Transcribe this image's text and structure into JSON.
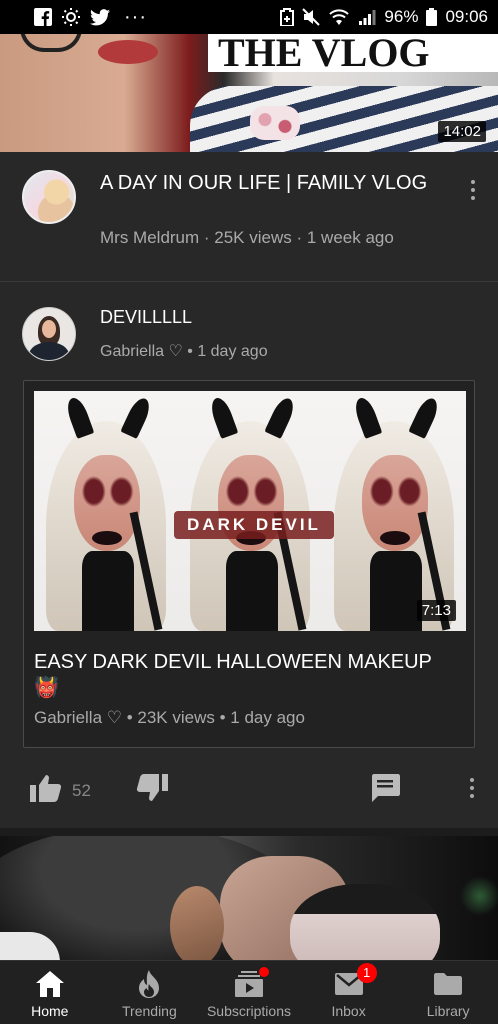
{
  "status_bar": {
    "left_icons": [
      "facebook-icon",
      "brightness-icon",
      "twitter-icon"
    ],
    "more": "···",
    "right_icons": [
      "data-saver-icon",
      "mute-icon",
      "wifi-icon",
      "signal-icon",
      "battery-icon"
    ],
    "battery": "96%",
    "time": "09:06"
  },
  "top_video": {
    "banner_text": "THE VLOG",
    "duration": "14:02",
    "title": "A DAY IN OUR LIFE | FAMILY VLOG",
    "channel_meta": "Mrs Meldrum · 25K views · 1 week ago"
  },
  "post": {
    "title": "DEVILLLLL",
    "meta": "Gabriella ♡ • 1 day ago",
    "embed": {
      "thumb_text": "DARK DEVIL",
      "duration": "7:13",
      "title": "EASY DARK DEVIL HALLOWEEN MAKEUP 👹",
      "meta": "Gabriella ♡ • 23K views • 1 day ago"
    },
    "actions": {
      "like_count": "52"
    }
  },
  "bottom_nav": {
    "items": [
      {
        "label": "Home",
        "icon": "home-icon",
        "active": true
      },
      {
        "label": "Trending",
        "icon": "flame-icon"
      },
      {
        "label": "Subscriptions",
        "icon": "subscriptions-icon"
      },
      {
        "label": "Inbox",
        "icon": "inbox-icon",
        "badge": "1"
      },
      {
        "label": "Library",
        "icon": "folder-icon"
      }
    ]
  },
  "colors": {
    "background": "#282828",
    "nav_background": "#212121",
    "text_primary": "#ffffff",
    "text_secondary": "#aaaaaa",
    "badge_red": "#ff0000"
  }
}
